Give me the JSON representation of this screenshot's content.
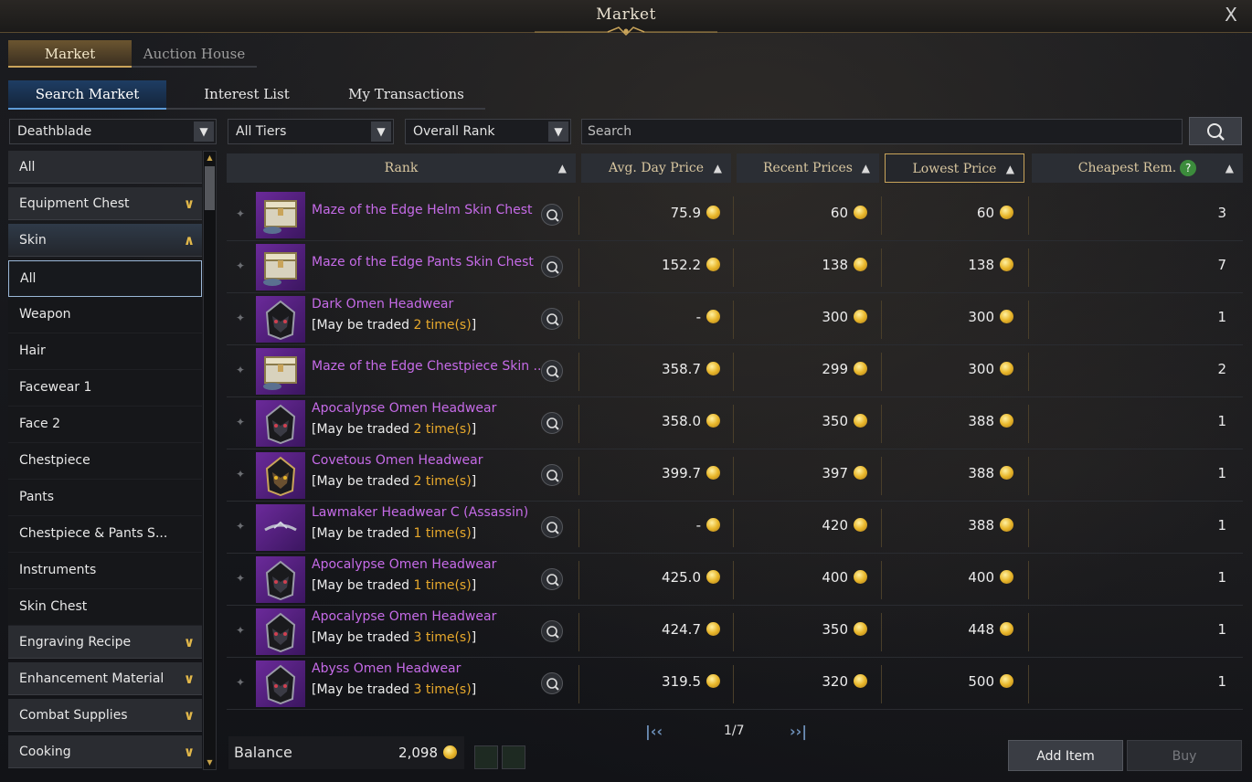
{
  "window": {
    "title": "Market",
    "close_label": "X"
  },
  "top_tabs": [
    {
      "label": "Market",
      "active": true
    },
    {
      "label": "Auction House",
      "active": false
    }
  ],
  "sub_tabs": [
    {
      "label": "Search Market",
      "active": true
    },
    {
      "label": "Interest List",
      "active": false
    },
    {
      "label": "My Transactions",
      "active": false
    }
  ],
  "filters": {
    "class": "Deathblade",
    "tier": "All Tiers",
    "sort": "Overall Rank",
    "search_placeholder": "Search"
  },
  "sidebar": {
    "categories": [
      {
        "label": "All",
        "type": "cat"
      },
      {
        "label": "Equipment Chest",
        "type": "cat",
        "chevron": "down"
      },
      {
        "label": "Skin",
        "type": "cat",
        "chevron": "up",
        "open": true
      },
      {
        "label": "All",
        "type": "sub",
        "selected": true
      },
      {
        "label": "Weapon",
        "type": "sub"
      },
      {
        "label": "Hair",
        "type": "sub"
      },
      {
        "label": "Facewear 1",
        "type": "sub"
      },
      {
        "label": "Face 2",
        "type": "sub"
      },
      {
        "label": "Chestpiece",
        "type": "sub"
      },
      {
        "label": "Pants",
        "type": "sub"
      },
      {
        "label": "Chestpiece & Pants S...",
        "type": "sub"
      },
      {
        "label": "Instruments",
        "type": "sub"
      },
      {
        "label": "Skin Chest",
        "type": "sub"
      },
      {
        "label": "Engraving Recipe",
        "type": "cat",
        "chevron": "down"
      },
      {
        "label": "Enhancement Material",
        "type": "cat",
        "chevron": "down"
      },
      {
        "label": "Combat Supplies",
        "type": "cat",
        "chevron": "down"
      },
      {
        "label": "Cooking",
        "type": "cat",
        "chevron": "down"
      }
    ]
  },
  "table": {
    "headers": {
      "rank": "Rank",
      "avg": "Avg. Day Price",
      "recent": "Recent Prices",
      "lowest": "Lowest Price",
      "remaining": "Cheapest Rem."
    },
    "trade_prefix": "[May be traded ",
    "trade_suffix": " time(s)",
    "trade_close": "]",
    "rows": [
      {
        "name": "Maze of the Edge Helm Skin Chest",
        "trades": null,
        "avg": "75.9",
        "recent": "60",
        "lowest": "60",
        "remaining": "3",
        "icon": "chest"
      },
      {
        "name": "Maze of the Edge Pants Skin Chest",
        "trades": null,
        "avg": "152.2",
        "recent": "138",
        "lowest": "138",
        "remaining": "7",
        "icon": "chest"
      },
      {
        "name": "Dark Omen Headwear",
        "trades": "2",
        "avg": "-",
        "recent": "300",
        "lowest": "300",
        "remaining": "1",
        "icon": "helm"
      },
      {
        "name": "Maze of the Edge Chestpiece Skin ...",
        "trades": null,
        "avg": "358.7",
        "recent": "299",
        "lowest": "300",
        "remaining": "2",
        "icon": "chest"
      },
      {
        "name": "Apocalypse Omen Headwear",
        "trades": "2",
        "avg": "358.0",
        "recent": "350",
        "lowest": "388",
        "remaining": "1",
        "icon": "helm"
      },
      {
        "name": "Covetous Omen Headwear",
        "trades": "2",
        "avg": "399.7",
        "recent": "397",
        "lowest": "388",
        "remaining": "1",
        "icon": "helm-gold"
      },
      {
        "name": "Lawmaker Headwear C (Assassin)",
        "trades": "1",
        "avg": "-",
        "recent": "420",
        "lowest": "388",
        "remaining": "1",
        "icon": "circlet"
      },
      {
        "name": "Apocalypse Omen Headwear",
        "trades": "1",
        "avg": "425.0",
        "recent": "400",
        "lowest": "400",
        "remaining": "1",
        "icon": "helm"
      },
      {
        "name": "Apocalypse Omen Headwear",
        "trades": "3",
        "avg": "424.7",
        "recent": "350",
        "lowest": "448",
        "remaining": "1",
        "icon": "helm"
      },
      {
        "name": "Abyss Omen Headwear",
        "trades": "3",
        "avg": "319.5",
        "recent": "320",
        "lowest": "500",
        "remaining": "1",
        "icon": "helm"
      }
    ]
  },
  "pager": {
    "text": "1/7"
  },
  "footer": {
    "balance_label": "Balance",
    "balance_value": "2,098",
    "add_item": "Add Item",
    "buy": "Buy"
  }
}
